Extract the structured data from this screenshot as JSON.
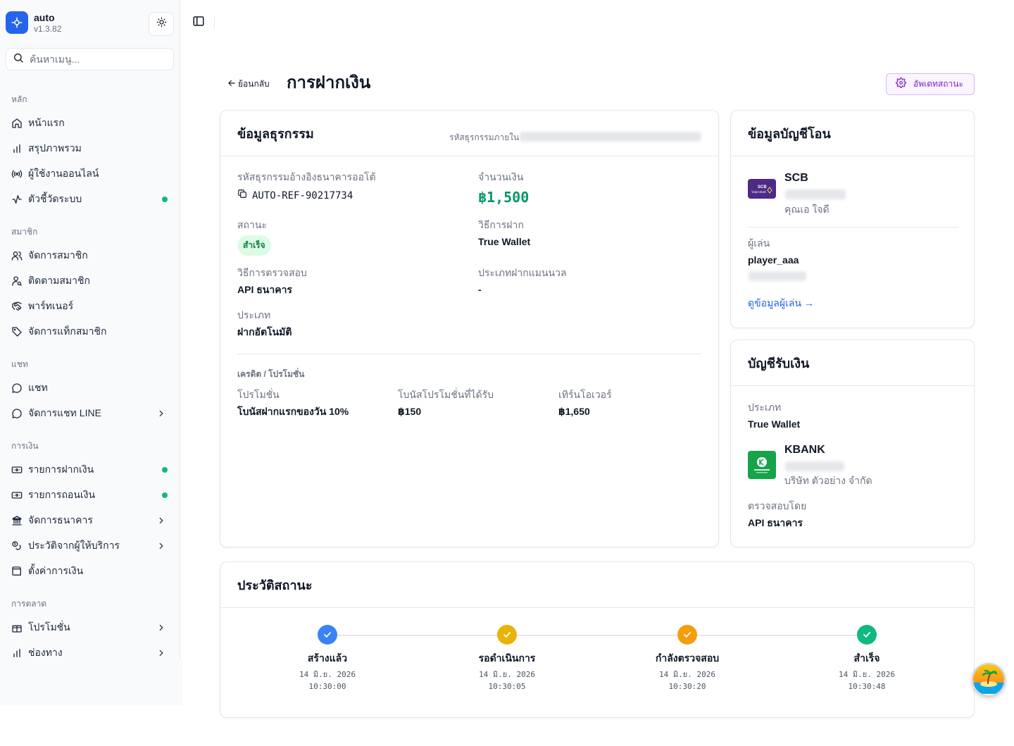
{
  "app": {
    "name": "auto",
    "version": "v1.3.82"
  },
  "search": {
    "placeholder": "ค้นหาเมนู..."
  },
  "sidebar": {
    "sections": [
      {
        "label": "หลัก"
      },
      {
        "label": "สมาชิก"
      },
      {
        "label": "แชท"
      },
      {
        "label": "การเงิน"
      },
      {
        "label": "การตลาด"
      }
    ],
    "items": [
      {
        "label": "หน้าแรก",
        "icon": "home-icon"
      },
      {
        "label": "สรุปภาพรวม",
        "icon": "bar-chart-icon"
      },
      {
        "label": "ผู้ใช้งานออนไลน์",
        "icon": "broadcast-icon"
      },
      {
        "label": "ตัวชี้วัดระบบ",
        "icon": "activity-icon"
      },
      {
        "label": "จัดการสมาชิก",
        "icon": "users-icon"
      },
      {
        "label": "ติดตามสมาชิก",
        "icon": "user-search-icon"
      },
      {
        "label": "พาร์ทเนอร์",
        "icon": "handshake-icon"
      },
      {
        "label": "จัดการแท็กสมาชิก",
        "icon": "tag-icon"
      },
      {
        "label": "แชท",
        "icon": "chat-icon"
      },
      {
        "label": "จัดการแชท LINE",
        "icon": "chat-icon"
      },
      {
        "label": "รายการฝากเงิน",
        "icon": "deposit-icon"
      },
      {
        "label": "รายการถอนเงิน",
        "icon": "withdraw-icon"
      },
      {
        "label": "จัดการธนาคาร",
        "icon": "bank-icon"
      },
      {
        "label": "ประวัติจากผู้ให้บริการ",
        "icon": "coins-icon"
      },
      {
        "label": "ตั้งค่าการเงิน",
        "icon": "wallet-icon"
      },
      {
        "label": "โปรโมชั่น",
        "icon": "gift-icon"
      },
      {
        "label": "ช่องทาง",
        "icon": "bar-chart-icon"
      }
    ],
    "status_color": "#10b981"
  },
  "header": {
    "back_label": "ย้อนกลับ",
    "title": "การฝากเงิน",
    "update_label": "อัพเดทสถานะ"
  },
  "transaction": {
    "title": "ข้อมูลธุรกรรม",
    "internal_id_label": "รหัสธุรกรรมภายใน",
    "ref_label": "รหัสธุรกรรมอ้างอิงธนาคารออโต้",
    "ref_value": "AUTO-REF-90217734",
    "amount_label": "จำนวนเงิน",
    "amount_value": "฿1,500",
    "status_label": "สถานะ",
    "status_value": "สำเร็จ",
    "method_label": "วิธีการฝาก",
    "method_value": "True Wallet",
    "verify_label": "วิธีการตรวจสอบ",
    "verify_value": "API ธนาคาร",
    "manual_type_label": "ประเภทฝากแมนนวล",
    "manual_type_value": "-",
    "type_label": "ประเภท",
    "type_value": "ฝากอัตโนมัติ",
    "credit_section": "เครดิต / โปรโมชั่น",
    "promo_label": "โปรโมชั่น",
    "promo_value": "โบนัสฝากแรกของวัน 10%",
    "bonus_label": "โบนัสโปรโมชั่นที่ได้รับ",
    "bonus_value": "฿150",
    "turnover_label": "เทิร์นโอเวอร์",
    "turnover_value": "฿1,650"
  },
  "sender": {
    "title": "ข้อมูลบัญชีโอน",
    "bank": "SCB",
    "account_name": "คุณเอ ใจดี",
    "player_label": "ผู้เล่น",
    "player_value": "player_aaa",
    "view_link": "ดูข้อมูลผู้เล่น →",
    "bank_color": "#4c2a85"
  },
  "receiver": {
    "title": "บัญชีรับเงิน",
    "type_label": "ประเภท",
    "type_value": "True Wallet",
    "bank": "KBANK",
    "account_name": "บริษัท ตัวอย่าง จำกัด",
    "verified_label": "ตรวจสอบโดย",
    "verified_value": "API ธนาคาร",
    "bank_color": "#16a34a"
  },
  "history": {
    "title": "ประวัติสถานะ",
    "steps": [
      {
        "label": "สร้างแล้ว",
        "date": "14 มิ.ย. 2026",
        "time": "10:30:00",
        "color": "#3b82f6"
      },
      {
        "label": "รอดำเนินการ",
        "date": "14 มิ.ย. 2026",
        "time": "10:30:05",
        "color": "#eab308"
      },
      {
        "label": "กำลังตรวจสอบ",
        "date": "14 มิ.ย. 2026",
        "time": "10:30:20",
        "color": "#f59e0b"
      },
      {
        "label": "สำเร็จ",
        "date": "14 มิ.ย. 2026",
        "time": "10:30:48",
        "color": "#10b981"
      }
    ]
  }
}
